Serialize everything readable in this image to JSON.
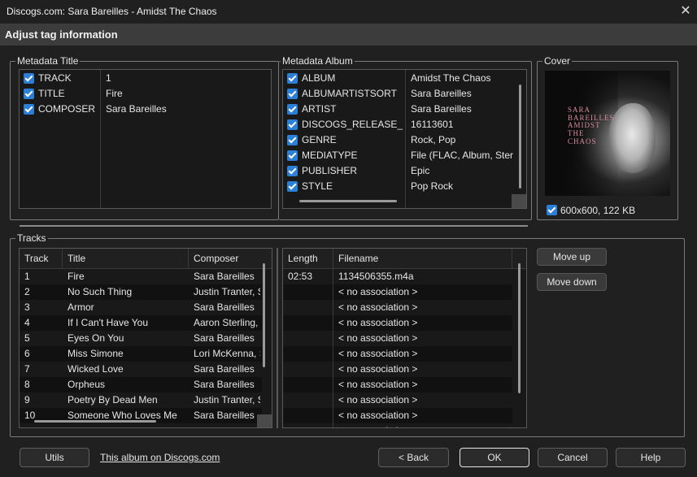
{
  "window": {
    "title": "Discogs.com: Sara Bareilles - Amidst The Chaos",
    "close_glyph": "✕"
  },
  "header": {
    "title": "Adjust tag information"
  },
  "metadata_title": {
    "label": "Metadata Title",
    "rows": [
      {
        "key": "TRACK",
        "value": "1",
        "checked": true
      },
      {
        "key": "TITLE",
        "value": "Fire",
        "checked": true
      },
      {
        "key": "COMPOSER",
        "value": "Sara Bareilles",
        "checked": true
      }
    ]
  },
  "metadata_album": {
    "label": "Metadata Album",
    "rows": [
      {
        "key": "ALBUM",
        "value": "Amidst The Chaos",
        "checked": true
      },
      {
        "key": "ALBUMARTISTSORT",
        "value": "Sara Bareilles",
        "checked": true
      },
      {
        "key": "ARTIST",
        "value": "Sara Bareilles",
        "checked": true
      },
      {
        "key": "DISCOGS_RELEASE_ID",
        "value": "16113601",
        "checked": true
      },
      {
        "key": "GENRE",
        "value": "Rock, Pop",
        "checked": true
      },
      {
        "key": "MEDIATYPE",
        "value": "File (FLAC, Album, Stereo)",
        "checked": true
      },
      {
        "key": "PUBLISHER",
        "value": "Epic",
        "checked": true
      },
      {
        "key": "STYLE",
        "value": "Pop Rock",
        "checked": true
      }
    ]
  },
  "cover": {
    "label": "Cover",
    "info": "600x600, 122 KB",
    "checked": true,
    "art_text_artist": "SARA BAREILLES",
    "art_text_album": "AMIDST THE CHAOS"
  },
  "tracks": {
    "label": "Tracks",
    "columns": [
      "Track",
      "Title",
      "Composer"
    ],
    "rows": [
      {
        "track": "1",
        "title": "Fire",
        "composer": "Sara Bareilles"
      },
      {
        "track": "2",
        "title": "No Such Thing",
        "composer": "Justin Tranter, Sara Bareilles"
      },
      {
        "track": "3",
        "title": "Armor",
        "composer": "Sara Bareilles"
      },
      {
        "track": "4",
        "title": "If I Can't Have You",
        "composer": "Aaron Sterling, Sara Bareilles"
      },
      {
        "track": "5",
        "title": "Eyes On You",
        "composer": "Sara Bareilles"
      },
      {
        "track": "6",
        "title": "Miss Simone",
        "composer": "Lori McKenna, Sara Bareilles"
      },
      {
        "track": "7",
        "title": "Wicked Love",
        "composer": "Sara Bareilles"
      },
      {
        "track": "8",
        "title": "Orpheus",
        "composer": "Sara Bareilles"
      },
      {
        "track": "9",
        "title": "Poetry By Dead Men",
        "composer": "Justin Tranter, Sara Bareilles"
      },
      {
        "track": "10",
        "title": "Someone Who Loves Me",
        "composer": "Sara Bareilles"
      }
    ]
  },
  "files": {
    "columns": [
      "Length",
      "Filename"
    ],
    "rows": [
      {
        "length": "02:53",
        "filename": "1134506355.m4a"
      },
      {
        "length": "",
        "filename": "< no association >"
      },
      {
        "length": "",
        "filename": "< no association >"
      },
      {
        "length": "",
        "filename": "< no association >"
      },
      {
        "length": "",
        "filename": "< no association >"
      },
      {
        "length": "",
        "filename": "< no association >"
      },
      {
        "length": "",
        "filename": "< no association >"
      },
      {
        "length": "",
        "filename": "< no association >"
      },
      {
        "length": "",
        "filename": "< no association >"
      },
      {
        "length": "",
        "filename": "< no association >"
      },
      {
        "length": "",
        "filename": "< no association >"
      }
    ]
  },
  "side_buttons": {
    "move_up": "Move up",
    "move_down": "Move down"
  },
  "footer": {
    "utils": "Utils",
    "discogs_link": "This album on Discogs.com",
    "back": "< Back",
    "ok": "OK",
    "cancel": "Cancel",
    "help": "Help"
  },
  "colors": {
    "checkbox": "#2c7fd6",
    "background": "#202020",
    "list_background": "#191919"
  }
}
